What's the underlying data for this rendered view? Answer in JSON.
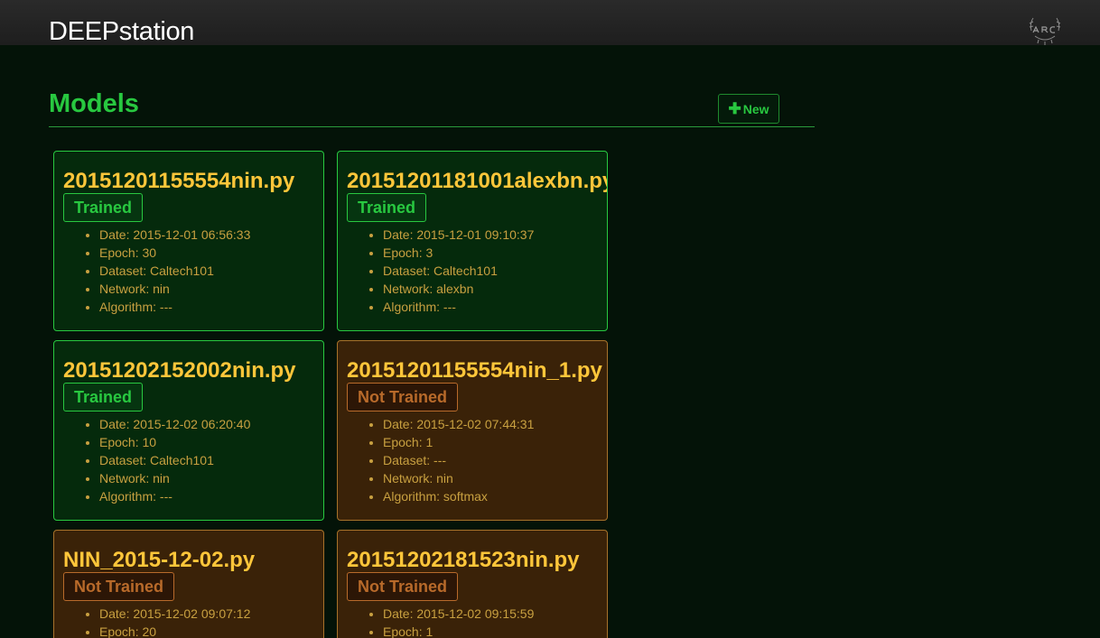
{
  "brand": {
    "part1": "DEEP",
    "part2": "station"
  },
  "page": {
    "title": "Models",
    "new_label": "New"
  },
  "colors": {
    "trained": "#28c840",
    "not_trained": "#b86a2a",
    "model_name": "#ffc63a"
  },
  "models": [
    {
      "name": "20151201155554nin.py",
      "status": "Trained",
      "fields": [
        "Date: 2015-12-01 06:56:33",
        "Epoch: 30",
        "Dataset: Caltech101",
        "Network: nin",
        "Algorithm: ---"
      ]
    },
    {
      "name": "20151201181001alexbn.py",
      "status": "Trained",
      "fields": [
        "Date: 2015-12-01 09:10:37",
        "Epoch: 3",
        "Dataset: Caltech101",
        "Network: alexbn",
        "Algorithm: ---"
      ]
    },
    {
      "name": "20151202152002nin.py",
      "status": "Trained",
      "fields": [
        "Date: 2015-12-02 06:20:40",
        "Epoch: 10",
        "Dataset: Caltech101",
        "Network: nin",
        "Algorithm: ---"
      ]
    },
    {
      "name": "20151201155554nin_1.py",
      "status": "Not Trained",
      "fields": [
        "Date: 2015-12-02 07:44:31",
        "Epoch: 1",
        "Dataset: ---",
        "Network: nin",
        "Algorithm: softmax"
      ]
    },
    {
      "name": "NIN_2015-12-02.py",
      "status": "Not Trained",
      "fields": [
        "Date: 2015-12-02 09:07:12",
        "Epoch: 20"
      ]
    },
    {
      "name": "20151202181523nin.py",
      "status": "Not Trained",
      "fields": [
        "Date: 2015-12-02 09:15:59",
        "Epoch: 1"
      ]
    }
  ]
}
